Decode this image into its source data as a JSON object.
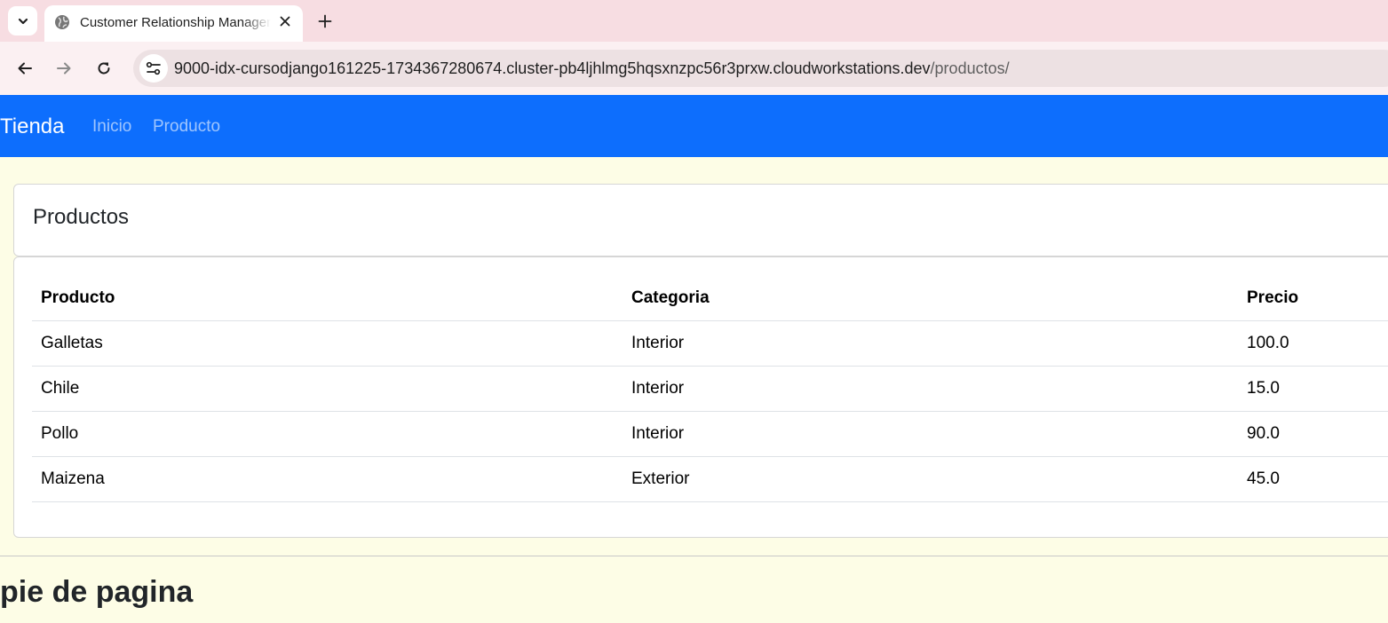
{
  "browser": {
    "tab_title": "Customer Relationship Management",
    "url_host": "9000-idx-cursodjango161225-1734367280674.cluster-pb4ljhlmg5hqsxnzpc56r3prxw.cloudworkstations.dev",
    "url_path": "/productos/",
    "icons": {
      "tab_search": "chevron-down-icon",
      "favicon": "globe-icon",
      "close": "close-icon",
      "new_tab": "plus-icon",
      "back": "back-arrow-icon",
      "forward": "forward-arrow-icon",
      "reload": "reload-icon",
      "site_info": "tune-icon"
    }
  },
  "navbar": {
    "brand": "Tienda",
    "links": [
      "Inicio",
      "Producto"
    ],
    "color": "#0d6efd"
  },
  "card": {
    "title": "Productos"
  },
  "table": {
    "headers": [
      "Producto",
      "Categoria",
      "Precio"
    ],
    "rows": [
      [
        "Galletas",
        "Interior",
        "100.0"
      ],
      [
        "Chile",
        "Interior",
        "15.0"
      ],
      [
        "Pollo",
        "Interior",
        "90.0"
      ],
      [
        "Maizena",
        "Exterior",
        "45.0"
      ]
    ]
  },
  "footer": {
    "text": "pie de pagina"
  }
}
